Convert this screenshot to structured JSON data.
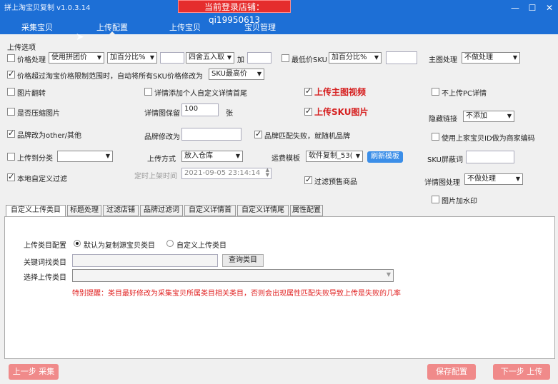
{
  "window": {
    "title": "拼上淘宝贝复制 v1.0.3.14",
    "shop_label": "当前登录店铺：qi19950613",
    "min": "—",
    "max": "☐",
    "close": "✕"
  },
  "nav": {
    "tabs": [
      "采集宝贝",
      "上传配置",
      "上传宝贝",
      "宝贝管理"
    ],
    "active_index": 1
  },
  "section": {
    "title": "上传选项"
  },
  "row1": {
    "price_label": "价格处理",
    "price_source": "使用拼团价",
    "price_mode": "加百分比%",
    "price_value": "",
    "rounding": "四舍五入取",
    "plus_label": "加",
    "plus_value": "",
    "min_sku_label": "最低价SKU",
    "min_sku_mode": "加百分比%",
    "min_sku_value": "",
    "main_img_label": "主图处理",
    "main_img_value": "不做处理"
  },
  "row2": {
    "limit_label": "价格超过淘宝价格限制范围时，自动将所有SKU价格修改为",
    "limit_value": "SKU最高价"
  },
  "row3": {
    "flip_label": "图片翻转",
    "custom_detail_label": "详情添加个人自定义详情首尾",
    "upload_video_label": "上传主图视频",
    "no_pc_detail_label": "不上传PC详情"
  },
  "row4": {
    "compress_label": "是否压缩图片",
    "keep_detail_label": "详情图保留",
    "keep_detail_value": "100",
    "keep_detail_unit": "张",
    "upload_sku_img_label": "上传SKU图片",
    "hide_link_label": "隐藏链接",
    "hide_link_value": "不添加"
  },
  "row5": {
    "brand_other_label": "品牌改为other/其他",
    "brand_modify_label": "品牌修改为",
    "brand_modify_value": "",
    "brand_match_label": "品牌匹配失败，就随机品牌",
    "use_id_label": "使用上家宝贝ID做为商家编码"
  },
  "row6": {
    "upload_category_label": "上传到分类",
    "upload_category_value": "",
    "upload_method_label": "上传方式",
    "upload_method_value": "放入仓库",
    "shipping_label": "运费模板",
    "shipping_value": "软件复制_53(",
    "refresh_label": "刷新模板",
    "sku_filter_label": "SKU屏蔽词",
    "sku_filter_value": ""
  },
  "row7": {
    "local_filter_label": "本地自定义过滤",
    "schedule_label": "定时上架时间",
    "schedule_value": "2021-09-05 23:14:14",
    "presale_filter_label": "过滤预售商品",
    "detail_img_label": "详情图处理",
    "detail_img_value": "不做处理"
  },
  "row8": {
    "watermark_label": "图片加水印"
  },
  "panel_tabs": [
    "自定义上传类目",
    "标题处理",
    "过滤店铺",
    "品牌过滤词",
    "自定义详情首",
    "自定义详情尾",
    "属性配置"
  ],
  "panel": {
    "category_config_label": "上传类目配置",
    "option_default": "默认为复制源宝贝类目",
    "option_custom": "自定义上传类目",
    "keyword_label": "关键词找类目",
    "keyword_value": "",
    "query_button": "查询类目",
    "select_label": "选择上传类目",
    "select_value": "",
    "warning": "特别提醒：类目最好修改为采集宝贝所属类目相关类目，否则会出现属性匹配失败导致上传是失败的几率"
  },
  "footer": {
    "prev": "上一步 采集",
    "save": "保存配置",
    "next": "下一步 上传"
  },
  "colors": {
    "title_bar": "#1d6fd6",
    "shop_badge": "#e52d2d",
    "accent_red": "#d62020",
    "button_red": "#f08a8a",
    "button_blue": "#3b8ee8"
  }
}
